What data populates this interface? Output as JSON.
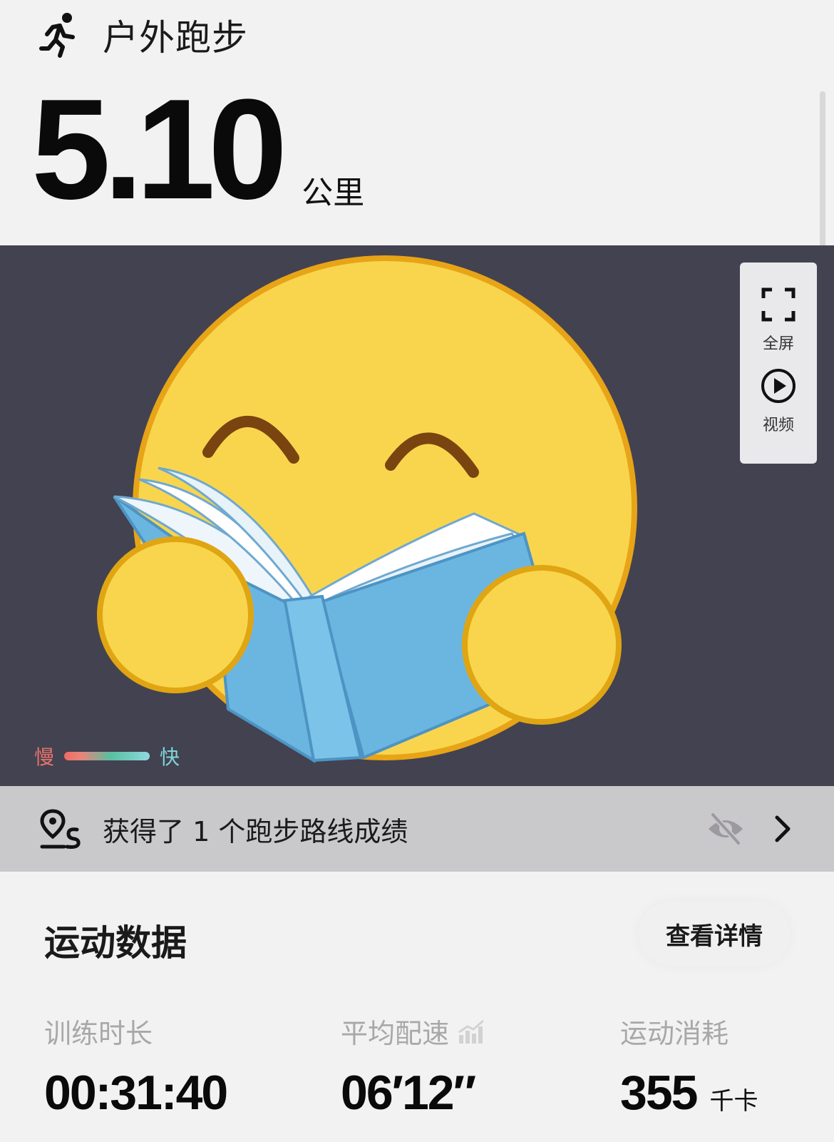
{
  "header": {
    "sport_name": "户外跑步",
    "distance": "5.10",
    "distance_unit": "公里"
  },
  "map": {
    "controls": {
      "fullscreen_label": "全屏",
      "video_label": "视频"
    },
    "legend": {
      "slow": "慢",
      "fast": "快"
    }
  },
  "achievement": {
    "text": "获得了 1 个跑步路线成绩"
  },
  "stats": {
    "title": "运动数据",
    "details_button": "查看详情",
    "metrics": [
      {
        "label": "训练时长",
        "value": "00:31:40",
        "unit": ""
      },
      {
        "label": "平均配速",
        "value": "06′12″",
        "unit": ""
      },
      {
        "label": "运动消耗",
        "value": "355",
        "unit": "千卡"
      }
    ]
  },
  "colors": {
    "map_background": "#434250",
    "emoji_face": "#f9d54e",
    "book": "#6bb6e0",
    "legend_slow": "#e8736c",
    "legend_fast": "#7fd6d8"
  },
  "icons": [
    "runner-icon",
    "fullscreen-icon",
    "play-icon",
    "route-pin-icon",
    "eye-off-icon",
    "chevron-right-icon",
    "bar-chart-icon"
  ]
}
